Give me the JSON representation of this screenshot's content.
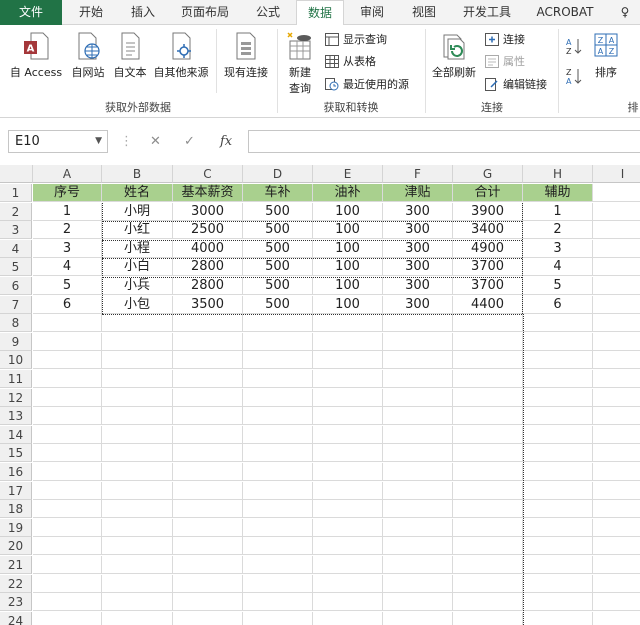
{
  "tabs": [
    "文件",
    "开始",
    "插入",
    "页面布局",
    "公式",
    "数据",
    "审阅",
    "视图",
    "开发工具",
    "ACROBAT",
    "♀"
  ],
  "ribbon": {
    "get_external": {
      "btn_access": "自 Access",
      "btn_web": "自网站",
      "btn_text": "自文本",
      "btn_other": "自其他来源",
      "btn_existing": "现有连接",
      "label": "获取外部数据"
    },
    "transform": {
      "btn_new_query": "新建",
      "btn_new_query2": "查询",
      "show_query": "显示查询",
      "from_table": "从表格",
      "recent_sources": "最近使用的源",
      "label": "获取和转换"
    },
    "connections": {
      "refresh_all": "全部刷新",
      "connections": "连接",
      "properties": "属性",
      "edit_links": "编辑链接",
      "label": "连接"
    },
    "sort": {
      "sort": "排序",
      "label": "排"
    }
  },
  "formula_bar": {
    "name_box": "E10",
    "cancel": "✕",
    "enter": "✓",
    "fx": "fx",
    "value": ""
  },
  "columns": [
    "A",
    "B",
    "C",
    "D",
    "E",
    "F",
    "G",
    "H",
    "I"
  ],
  "rows": [
    "1",
    "2",
    "3",
    "4",
    "5",
    "6",
    "7",
    "8",
    "9",
    "10",
    "11",
    "12",
    "13",
    "14",
    "15",
    "16",
    "17",
    "18",
    "19",
    "20",
    "21",
    "22",
    "23",
    "24"
  ],
  "table": {
    "header": [
      "序号",
      "姓名",
      "基本薪资",
      "车补",
      "油补",
      "津贴",
      "合计",
      "辅助"
    ],
    "data": [
      [
        "1",
        "小明",
        "3000",
        "500",
        "100",
        "300",
        "3900",
        "1"
      ],
      [
        "2",
        "小红",
        "2500",
        "500",
        "100",
        "300",
        "3400",
        "2"
      ],
      [
        "3",
        "小程",
        "4000",
        "500",
        "100",
        "300",
        "4900",
        "3"
      ],
      [
        "4",
        "小白",
        "2800",
        "500",
        "100",
        "300",
        "3700",
        "4"
      ],
      [
        "5",
        "小兵",
        "2800",
        "500",
        "100",
        "300",
        "3700",
        "5"
      ],
      [
        "6",
        "小包",
        "3500",
        "500",
        "100",
        "300",
        "4400",
        "6"
      ]
    ]
  },
  "colors": {
    "header_fill": "#a9d08e",
    "excel_green": "#217346"
  }
}
